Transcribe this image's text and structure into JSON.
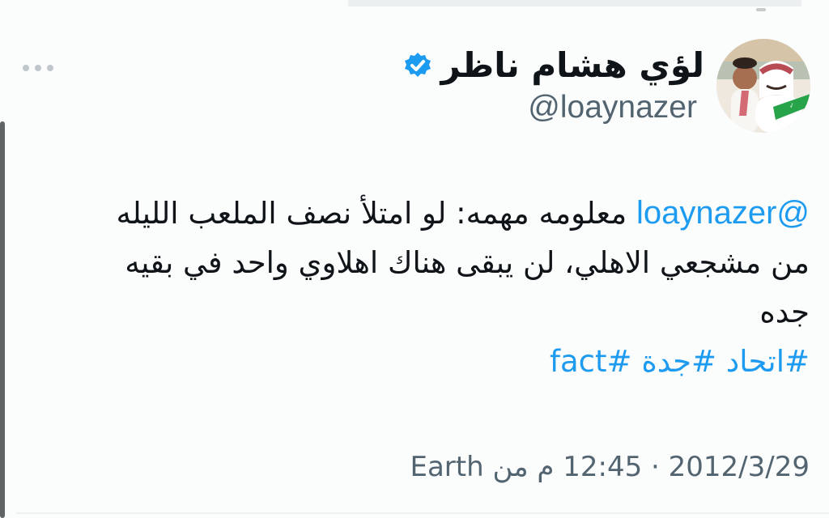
{
  "tweet": {
    "display_name": "لؤي هشام ناظر",
    "handle": "@loaynazer",
    "mention": "@loaynazer",
    "body_line_1": " معلومه مهمه: لو امتلأ نصف الملعب الليله",
    "body_line_2": "من مشجعي الاهلي، لن يبقى هناك اهلاوي واحد في بقيه",
    "body_line_3": "جده",
    "hashtags": [
      "#اتحاد",
      "#جدة",
      "#fact"
    ],
    "date": "2012/3/29",
    "separator": "·",
    "time": "12:45 م",
    "location_prefix": "من",
    "location": "Earth"
  },
  "icons": {
    "verified": "verified-badge-icon",
    "more": "more-options-icon"
  },
  "colors": {
    "link": "#1d9bf0",
    "text": "#0f1419",
    "muted": "#536471",
    "verified": "#1d9bf0"
  }
}
